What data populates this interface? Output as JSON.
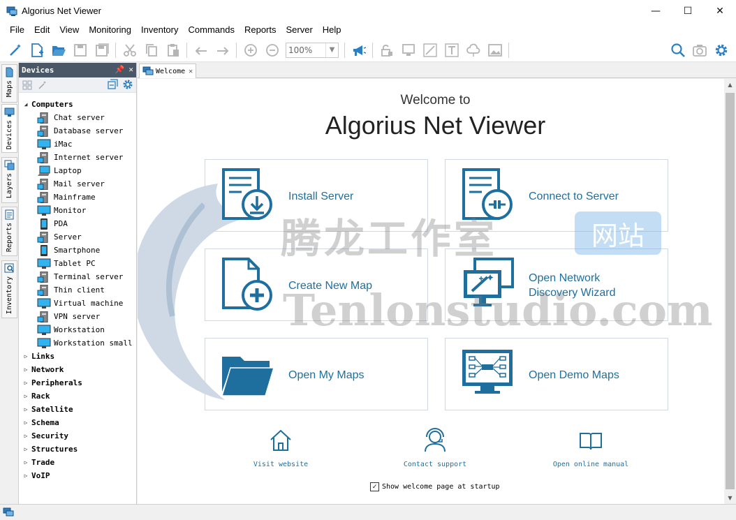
{
  "window": {
    "title": "Algorius Net Viewer"
  },
  "menu": [
    "File",
    "Edit",
    "View",
    "Monitoring",
    "Inventory",
    "Commands",
    "Reports",
    "Server",
    "Help"
  ],
  "toolbar": {
    "zoom": "100%"
  },
  "side_tabs": [
    "Maps",
    "Devices",
    "Layers",
    "Reports",
    "Inventory"
  ],
  "devices_panel": {
    "title": "Devices",
    "group_open": "Computers",
    "devices": [
      "Chat server",
      "Database server",
      "iMac",
      "Internet server",
      "Laptop",
      "Mail server",
      "Mainframe",
      "Monitor",
      "PDA",
      "Server",
      "Smartphone",
      "Tablet PC",
      "Terminal server",
      "Thin client",
      "Virtual machine",
      "VPN server",
      "Workstation",
      "Workstation small"
    ],
    "groups": [
      "Links",
      "Network",
      "Peripherals",
      "Rack",
      "Satellite",
      "Schema",
      "Security",
      "Structures",
      "Trade",
      "VoIP"
    ]
  },
  "doc_tab": {
    "label": "Welcome"
  },
  "welcome": {
    "welcome_to": "Welcome to",
    "app_name": "Algorius Net Viewer",
    "cards": {
      "install": "Install Server",
      "connect": "Connect to Server",
      "create": "Create New Map",
      "discovery_1": "Open Network",
      "discovery_2": "Discovery Wizard",
      "mymaps": "Open My Maps",
      "demo": "Open Demo Maps"
    },
    "links": {
      "website": "Visit website",
      "support": "Contact support",
      "manual": "Open online manual"
    },
    "startup_label": "Show welcome page at startup",
    "startup_checked": true
  },
  "watermark": {
    "cn": "腾龙工作室",
    "badge": "网站",
    "en": "Tenlonstudio.com"
  },
  "colors": {
    "accent": "#1e6f9e",
    "panel_header": "#4a5767"
  }
}
